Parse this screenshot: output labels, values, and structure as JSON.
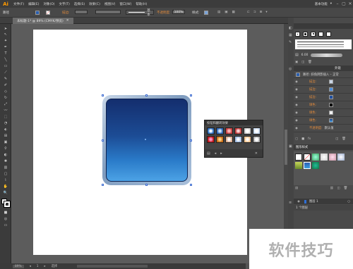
{
  "app": {
    "logo": "Ai",
    "menus": [
      "文件(F)",
      "编辑(E)",
      "对象(O)",
      "文字(T)",
      "选择(S)",
      "效果(C)",
      "视图(V)",
      "窗口(W)",
      "帮助(H)"
    ],
    "workspace": "基本功能",
    "win_min": "–",
    "win_max": "▢",
    "win_close": "✕"
  },
  "control_bar": {
    "selection_label": "路径",
    "stroke_label": "描边:",
    "stroke_style": "基本",
    "opacity_label": "不透明度:",
    "opacity_value": "100%",
    "style_label": "样式:"
  },
  "document_tab": {
    "title": "未标题-1* @ 89% (CMYK/预览)",
    "close": "✕"
  },
  "tools": [
    "selection-tool",
    "direct-selection-tool",
    "magic-wand-tool",
    "lasso-tool",
    "pen-tool",
    "type-tool",
    "line-tool",
    "rectangle-tool",
    "paintbrush-tool",
    "pencil-tool",
    "blob-brush-tool",
    "eraser-tool",
    "rotate-tool",
    "scale-tool",
    "warp-tool",
    "free-transform-tool",
    "shape-builder-tool",
    "perspective-tool",
    "mesh-tool",
    "gradient-tool",
    "eyedropper-tool",
    "blend-tool",
    "symbol-sprayer-tool",
    "column-graph-tool",
    "artboard-tool",
    "slice-tool",
    "hand-tool",
    "zoom-tool"
  ],
  "graphic_styles_panel": {
    "title": "按钮和翻转效果"
  },
  "brushes_panel": {
    "stroke_weight": "6.00"
  },
  "appearance_panel": {
    "tab_appearance": "外观",
    "header": "路径: 斜角阴影插入 – 正常",
    "rows": [
      {
        "label": "描边:"
      },
      {
        "label": "描边:"
      },
      {
        "label": "描边:"
      },
      {
        "label": "填色:"
      },
      {
        "label": "填色:"
      },
      {
        "label": "填色:"
      }
    ],
    "opacity_label": "不透明度:",
    "opacity_value": "默认值"
  },
  "graphic_styles_tab": {
    "title": "图形样式"
  },
  "layers_bar": {
    "count": "1 个图层"
  },
  "status_bar": {
    "zoom": "89%",
    "page": "1",
    "tool": "选择"
  },
  "watermark": {
    "text": "软件技巧"
  },
  "colors": {
    "orange": "#e08a3c",
    "menubar": "#3c3c3c",
    "face_top": "#142e6e",
    "face_bottom": "#4ca2e5"
  }
}
